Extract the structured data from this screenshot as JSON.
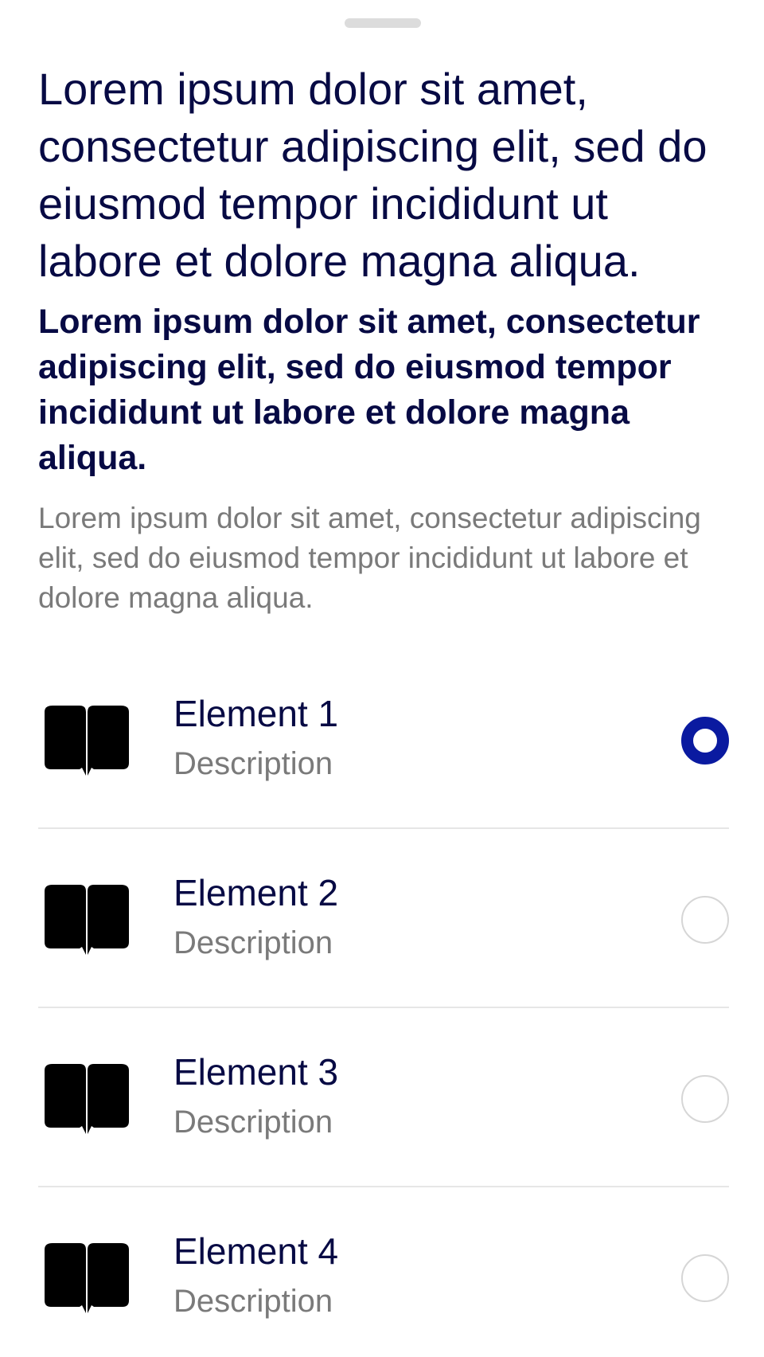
{
  "sheet": {
    "title": "Lorem ipsum dolor sit amet, consectetur adipiscing elit, sed do eiusmod tempor incididunt ut labore et dolore magna aliqua.",
    "subtitle": "Lorem ipsum dolor sit amet, consectetur adipiscing elit, sed do eiusmod tempor incididunt ut labore et dolore magna aliqua.",
    "body": "Lorem ipsum dolor sit amet, consectetur adipiscing elit, sed do eiusmod tempor incididunt ut labore et dolore magna aliqua."
  },
  "colors": {
    "primary_text": "#070a44",
    "secondary_text": "#7a7a7a",
    "accent": "#0a1aa0",
    "divider": "#e6e6e6"
  },
  "list": {
    "items": [
      {
        "icon": "book-icon",
        "title": "Element 1",
        "description": "Description",
        "selected": true
      },
      {
        "icon": "book-icon",
        "title": "Element 2",
        "description": "Description",
        "selected": false
      },
      {
        "icon": "book-icon",
        "title": "Element 3",
        "description": "Description",
        "selected": false
      },
      {
        "icon": "book-icon",
        "title": "Element 4",
        "description": "Description",
        "selected": false
      }
    ]
  }
}
